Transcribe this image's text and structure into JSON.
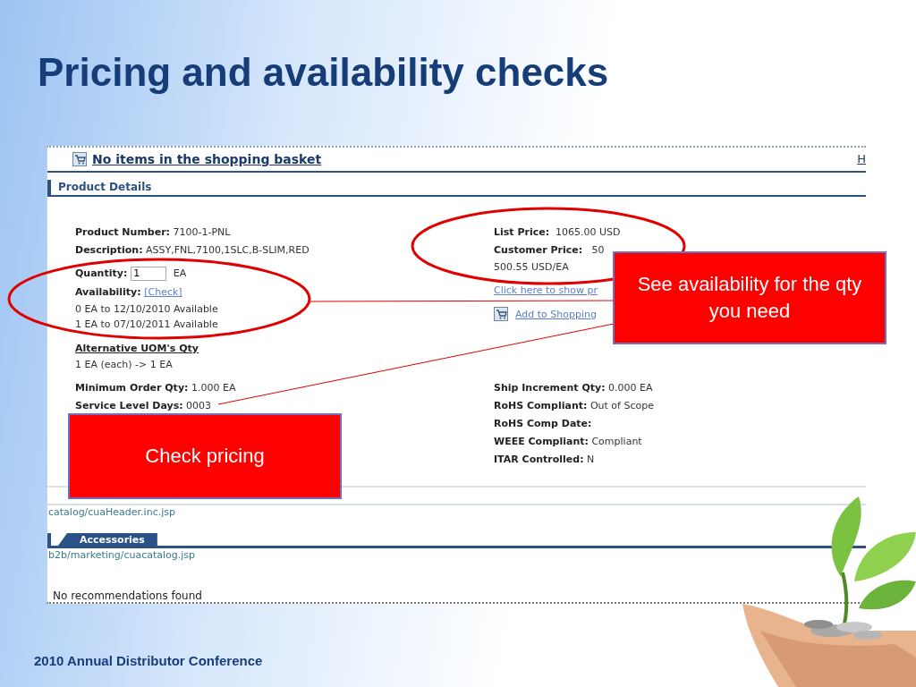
{
  "slide": {
    "title": "Pricing and availability checks",
    "footer": "2010 Annual Distributor Conference"
  },
  "screenshot": {
    "basket_link": "No items in the shopping basket",
    "corner_link": "H",
    "section_title": "Product Details",
    "left_fields": [
      {
        "label": "Product Number:",
        "value": "7100-1-PNL"
      },
      {
        "label": "Description:",
        "value": "ASSY,FNL,7100,1SLC,B-SLIM,RED"
      }
    ],
    "quantity": {
      "label": "Quantity:",
      "value": "1",
      "unit": "EA"
    },
    "availability": {
      "label": "Availability:",
      "link": "[Check]",
      "lines": [
        "0 EA to 12/10/2010 Available",
        "1 EA to 07/10/2011 Available"
      ]
    },
    "uom": {
      "heading": "Alternative UOM's Qty",
      "line": "1 EA (each) ->  1 EA"
    },
    "prices": {
      "list_label": "List Price:",
      "list_value": "1065.00 USD",
      "customer_label": "Customer Price:",
      "customer_value": "50",
      "unit_price": "500.55 USD/EA",
      "show_link": "Click here to show pr",
      "add_link": "Add to Shopping"
    },
    "lower_left": [
      {
        "label": "Minimum Order Qty:",
        "value": "1.000  EA"
      },
      {
        "label": "Service Level Days:",
        "value": "0003"
      }
    ],
    "lower_right": [
      {
        "label": "Ship Increment Qty:",
        "value": "0.000  EA"
      },
      {
        "label": "RoHS Compliant:",
        "value": "Out of Scope"
      },
      {
        "label": "RoHS Comp Date:"
      },
      {
        "label": "WEEE Compliant:",
        "value": "Compliant"
      },
      {
        "label": "ITAR Controlled:",
        "value": "N"
      }
    ],
    "header_path": "catalog/cuaHeader.inc.jsp",
    "accessories_tab": "Accessories",
    "marketing_path": "b2b/marketing/cuacatalog.jsp",
    "no_recommendations": "No recommendations found"
  },
  "callouts": [
    {
      "text": "See availability for the qty you need"
    },
    {
      "text": "Check pricing"
    }
  ]
}
